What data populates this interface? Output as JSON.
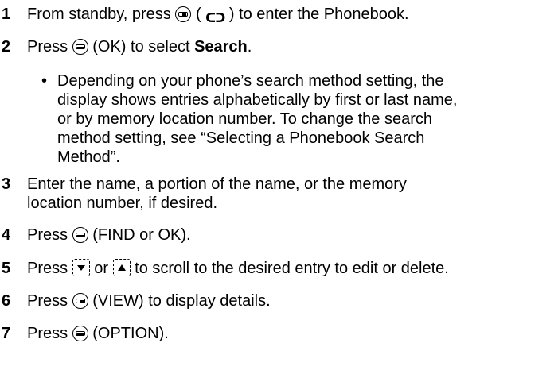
{
  "steps": [
    {
      "num": "1",
      "pre": "From standby, press",
      "mid": "( ",
      "icon2": "",
      "post": ") to enter the Phonebook.",
      "icon": "right-softkey-icon",
      "icon_b": "phonebook-icon"
    },
    {
      "num": "2",
      "pre": "Press",
      "post": "(OK) to select ",
      "bold": "Search",
      "tail": ".",
      "icon": "left-softkey-icon"
    },
    {
      "num": "3",
      "line1": "Enter the name, a portion of the name, or the memory",
      "line2": "location number, if desired."
    },
    {
      "num": "4",
      "pre": "Press",
      "post": "(FIND or OK).",
      "icon": "left-softkey-icon"
    },
    {
      "num": "5",
      "pre": "Press",
      "mid": "or",
      "post": "to scroll to the desired entry to edit or delete.",
      "icon": "nav-down-icon",
      "icon_b": "nav-up-icon"
    },
    {
      "num": "6",
      "pre": "Press",
      "post": "(VIEW) to display details.",
      "icon": "right-softkey-icon"
    },
    {
      "num": "7",
      "pre": "Press",
      "post": "(OPTION).",
      "icon": "center-softkey-icon"
    }
  ],
  "bullet": {
    "lines": [
      "Depending on your phone’s search method setting, the",
      "display shows entries alphabetically by first or last name,",
      "or by memory location number. To change the search",
      "method setting, see “Selecting a Phonebook Search",
      "Method”."
    ]
  }
}
